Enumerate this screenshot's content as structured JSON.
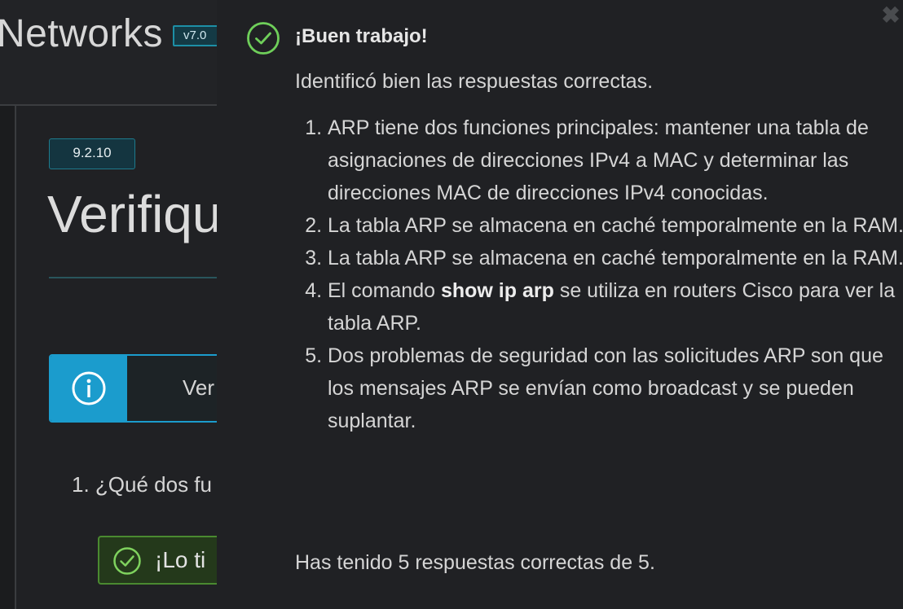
{
  "header": {
    "brand": "Networks",
    "version": "v7.0"
  },
  "content": {
    "section_number": "9.2.10",
    "page_title": "Verifique",
    "info_text": "Ver",
    "question": "1. ¿Qué dos fu",
    "got_it_label": "¡Lo ti"
  },
  "feedback": {
    "close_symbol": "✖",
    "title": "¡Buen trabajo!",
    "intro": "Identificó bien las respuestas correctas.",
    "items": [
      "ARP tiene dos funciones principales: mantener una tabla de asignaciones de direcciones IPv4 a MAC y determinar las direcciones MAC de direcciones IPv4 conocidas.",
      "La tabla ARP se almacena en caché temporalmente en la RAM.",
      "La tabla ARP se almacena en caché temporalmente en la RAM.",
      {
        "before": "El comando ",
        "bold": "show ip arp",
        "after": " se utiliza en routers Cisco para ver la tabla ARP."
      },
      "Dos problemas de seguridad con las solicitudes ARP son que los mensajes ARP se envían como broadcast y se pueden suplantar."
    ],
    "score": "Has tenido 5 respuestas correctas de 5."
  },
  "colors": {
    "background": "#202124",
    "accent_teal": "#1b9ccd",
    "success_green": "#6fcf5a"
  },
  "icons": {
    "feedback_check": "check-circle-icon",
    "info": "info-circle-icon",
    "got_it_check": "check-circle-icon",
    "close": "close-icon"
  }
}
